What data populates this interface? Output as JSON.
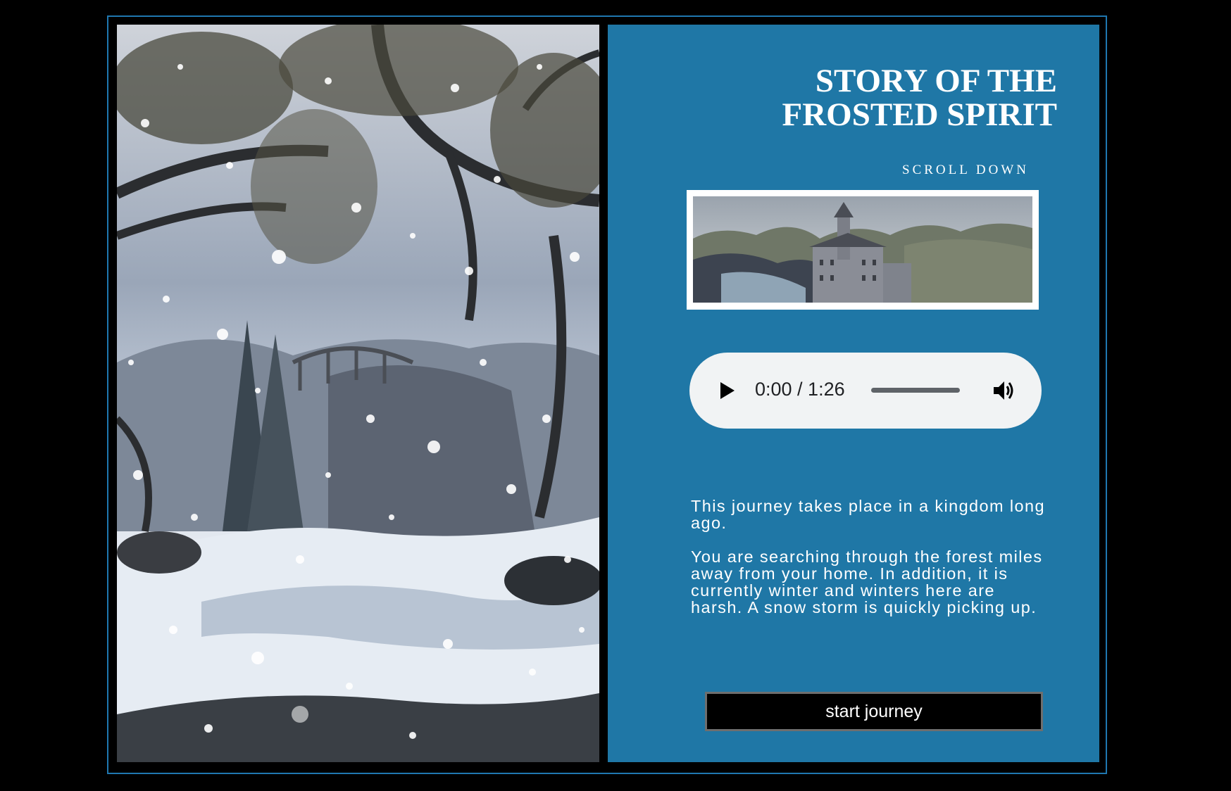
{
  "title": {
    "line1": "STORY OF THE",
    "line2": "FROSTED SPIRIT"
  },
  "scroll_hint": "SCROLL DOWN",
  "audio": {
    "time": "0:00 / 1:26",
    "progress": 0
  },
  "story": {
    "paragraph1": "This journey takes place in a kingdom long ago.",
    "paragraph2": "You are searching through the forest miles away from your home. In addition, it is currently winter and winters here are harsh. A snow storm is quickly picking up."
  },
  "start_button": "start journey",
  "colors": {
    "panel": "#1f77a6",
    "frame_border": "#1f77b0",
    "button_bg": "#000000"
  },
  "icons": {
    "play": "play-icon",
    "volume": "volume-icon"
  }
}
